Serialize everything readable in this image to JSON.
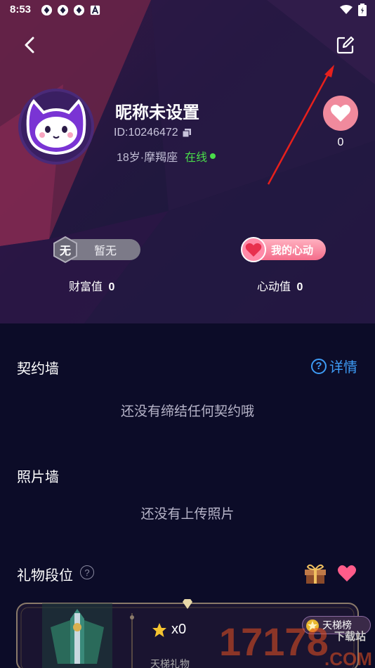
{
  "status_bar": {
    "time": "8:53"
  },
  "profile": {
    "nickname": "昵称未设置",
    "id_text": "ID:10246472",
    "age_zodiac": "18岁·摩羯座",
    "online_status": "在线",
    "like_count": "0"
  },
  "stats": {
    "wealth_badge_icon": "无",
    "wealth_badge_text": "暂无",
    "wealth_label": "财富值",
    "wealth_value": "0",
    "heart_badge_text": "我的心动",
    "heart_label": "心动值",
    "heart_value": "0"
  },
  "contract_wall": {
    "title": "契约墙",
    "details_label": "详情",
    "empty_text": "还没有缔结任何契约哦"
  },
  "photo_wall": {
    "title": "照片墙",
    "empty_text": "还没有上传照片"
  },
  "gift_rank": {
    "title": "礼物段位",
    "star_count": "x0",
    "subtitle": "天梯礼物",
    "ladder_button": "天梯榜"
  },
  "watermark": {
    "number": "17178",
    "suffix": ".COM",
    "label": "下载站"
  },
  "colors": {
    "background": "#0c0c28",
    "accent_blue": "#3d9bf5",
    "online_green": "#4ade4a",
    "heart_pink": "#f08a9d"
  }
}
